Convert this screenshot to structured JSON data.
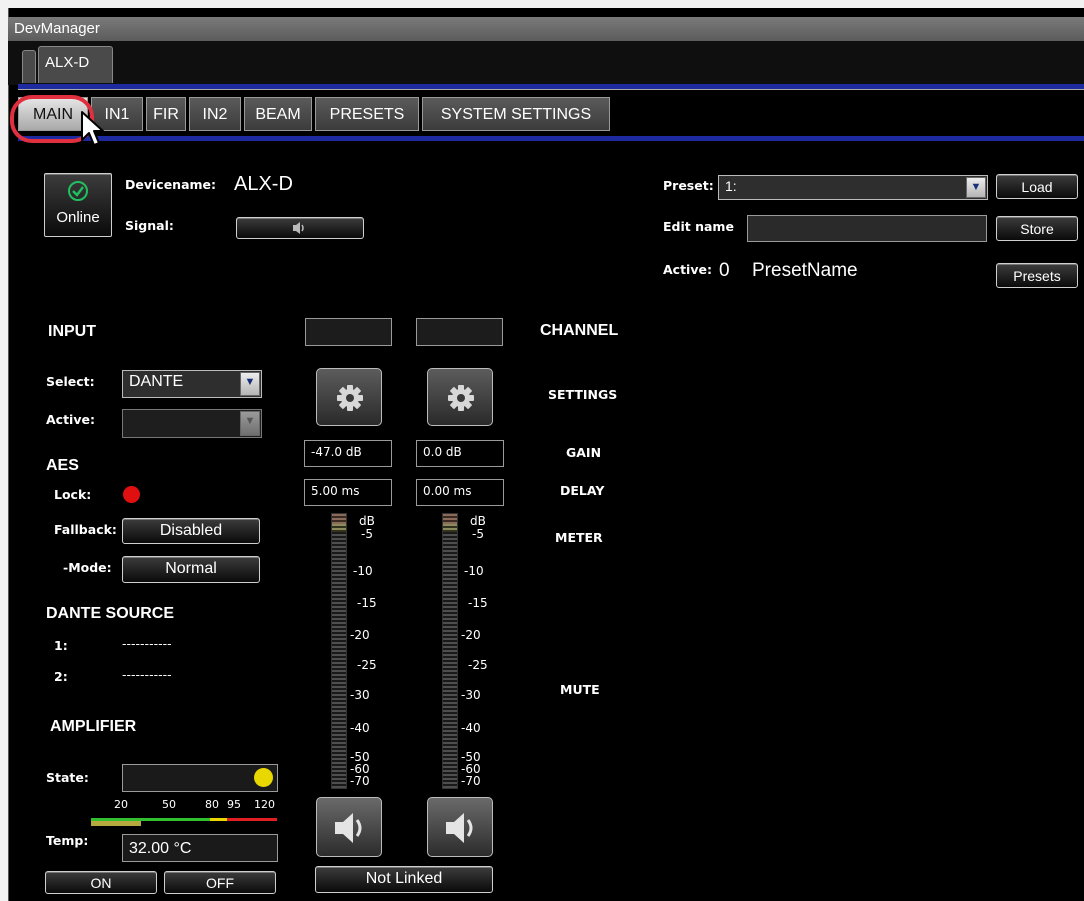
{
  "window": {
    "title": "DevManager"
  },
  "device_tabs": [
    "ALX-D"
  ],
  "tabs": [
    "MAIN",
    "IN1",
    "FIR",
    "IN2",
    "BEAM",
    "PRESETS",
    "SYSTEM SETTINGS"
  ],
  "device": {
    "online_label": "Online",
    "devicename_label": "Devicename:",
    "devicename_value": "ALX-D",
    "signal_label": "Signal:"
  },
  "preset": {
    "preset_label": "Preset:",
    "preset_value": "1:",
    "load_label": "Load",
    "edit_name_label": "Edit name",
    "edit_name_value": "",
    "store_label": "Store",
    "active_label": "Active:",
    "active_value": "0",
    "active_name": "PresetName",
    "presets_label": "Presets"
  },
  "input": {
    "heading": "INPUT",
    "select_label": "Select:",
    "select_value": "DANTE",
    "active_label": "Active:",
    "active_value": ""
  },
  "aes": {
    "heading": "AES",
    "lock_label": "Lock:",
    "lock_color": "#e01010",
    "fallback_label": "Fallback:",
    "fallback_value": "Disabled",
    "mode_label": "-Mode:",
    "mode_value": "Normal"
  },
  "dante_source": {
    "heading": "DANTE SOURCE",
    "rows": [
      {
        "label": "1:",
        "value": "-----------"
      },
      {
        "label": "2:",
        "value": "-----------"
      }
    ]
  },
  "amplifier": {
    "heading": "AMPLIFIER",
    "state_label": "State:",
    "state_color": "#e8d800",
    "scale_ticks": [
      "20",
      "50",
      "80",
      "95",
      "120"
    ],
    "temp_label": "Temp:",
    "temp_value": "32.00 °C",
    "on_label": "ON",
    "off_label": "OFF"
  },
  "channel": {
    "heading": "CHANNEL",
    "settings_label": "SETTINGS",
    "gain_label": "GAIN",
    "delay_label": "DELAY",
    "meter_label": "METER",
    "mute_label": "MUTE",
    "link_label": "Not Linked",
    "meter_ticks": [
      "dB",
      "-5",
      "-10",
      "-15",
      "-20",
      "-25",
      "-30",
      "-40",
      "-50",
      "-60",
      "-70"
    ],
    "channels": [
      {
        "name": "",
        "gain": "-47.0 dB",
        "delay": "5.00 ms"
      },
      {
        "name": "",
        "gain": "0.0 dB",
        "delay": "0.00 ms"
      }
    ]
  },
  "colors": {
    "tab_divider_blue": "#1e2aa0",
    "highlight_circle": "#e03040",
    "online_icon": "#20c060"
  },
  "icons": [
    "check-circle-icon",
    "speaker-icon",
    "gear-icon",
    "chevron-down-icon",
    "mouse-cursor-icon"
  ]
}
